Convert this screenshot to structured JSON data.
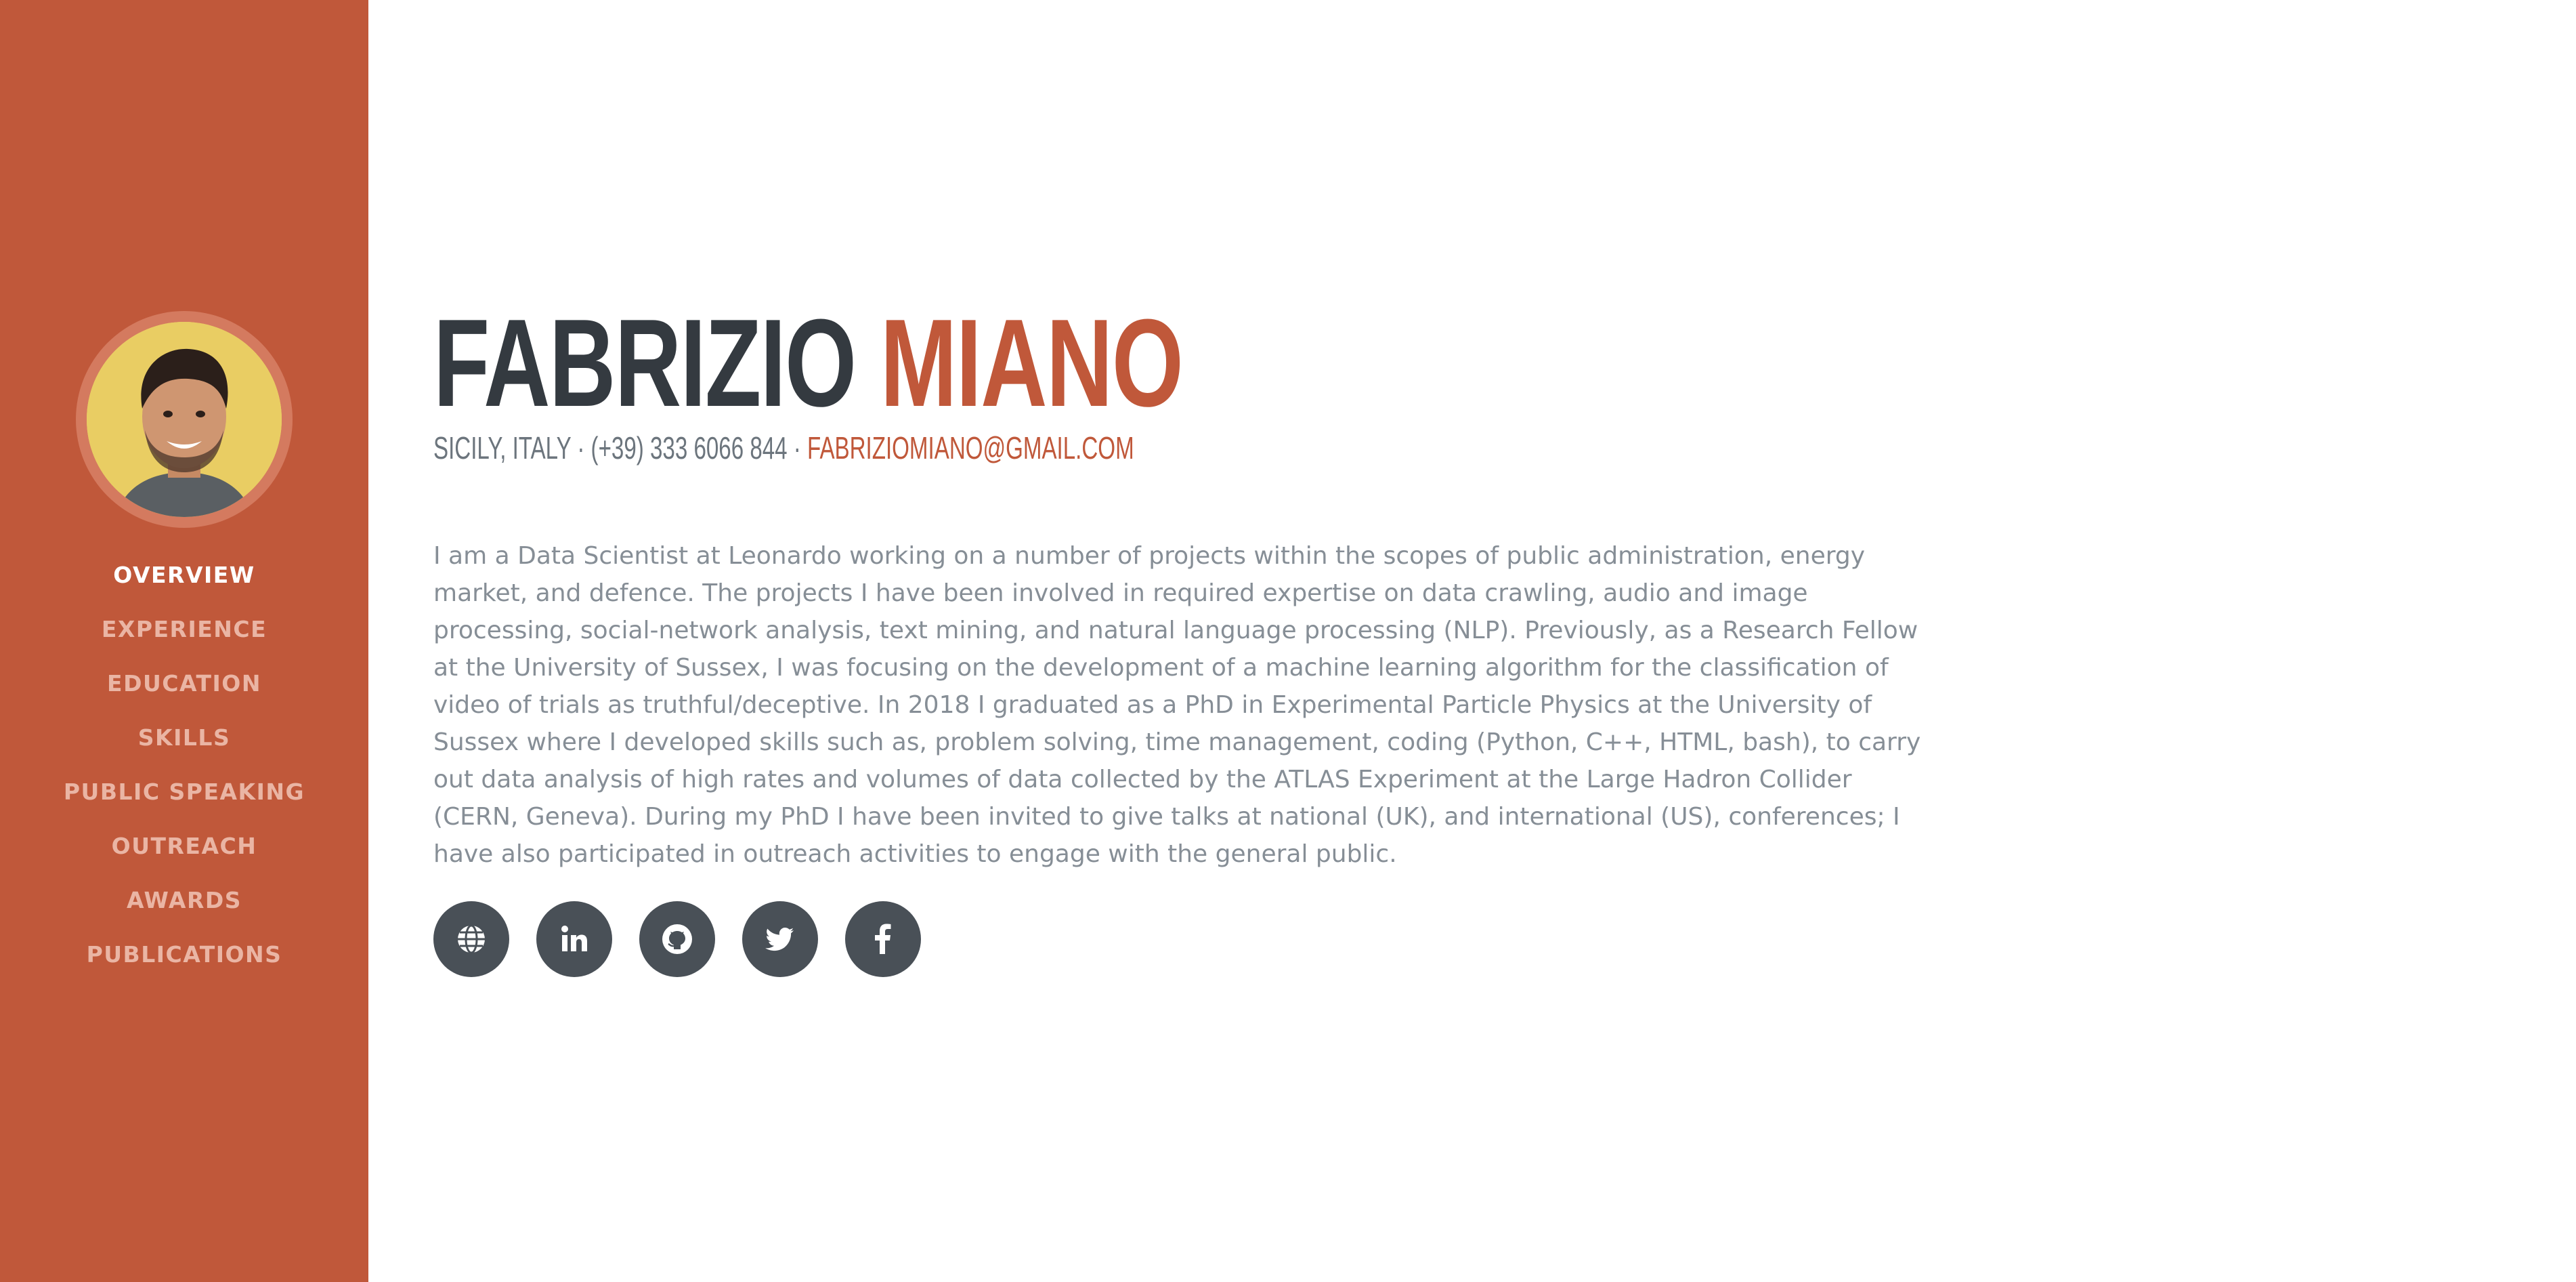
{
  "profile": {
    "first_name": "FABRIZIO",
    "last_name": "MIANO",
    "location_phone": "SICILY, ITALY · (+39) 333 6066 844 · ",
    "email": "FABRIZIOMIANO@GMAIL.COM",
    "bio": "I am a Data Scientist at Leonardo working on a number of projects within the scopes of public administration, energy market, and defence. The projects I have been involved in required expertise on data crawling, audio and image processing, social-network analysis, text mining, and natural language processing (NLP). Previously, as a Research Fellow at the University of Sussex, I was focusing on the development of a machine learning algorithm for the classification of video of trials as truthful/deceptive. In 2018 I graduated as a PhD in Experimental Particle Physics at the University of Sussex where I developed skills such as, problem solving, time management, coding (Python, C++, HTML, bash), to carry out data analysis of high rates and volumes of data collected by the ATLAS Experiment at the Large Hadron Collider (CERN, Geneva). During my PhD I have been invited to give talks at national (UK), and international (US), conferences; I have also participated in outreach activities to engage with the general public."
  },
  "sidebar": {
    "avatar_icon": "profile-photo",
    "items": [
      {
        "label": "OVERVIEW",
        "active": true
      },
      {
        "label": "EXPERIENCE",
        "active": false
      },
      {
        "label": "EDUCATION",
        "active": false
      },
      {
        "label": "SKILLS",
        "active": false
      },
      {
        "label": "PUBLIC SPEAKING",
        "active": false
      },
      {
        "label": "OUTREACH",
        "active": false
      },
      {
        "label": "AWARDS",
        "active": false
      },
      {
        "label": "PUBLICATIONS",
        "active": false
      }
    ]
  },
  "social_links": [
    {
      "icon": "globe-icon"
    },
    {
      "icon": "linkedin-icon"
    },
    {
      "icon": "github-icon"
    },
    {
      "icon": "twitter-icon"
    },
    {
      "icon": "facebook-icon"
    }
  ],
  "colors": {
    "accent": "#c0583a",
    "heading": "#343a40",
    "text_muted": "#868e96",
    "nav_inactive": "#eab5a4",
    "social_bg": "#495057"
  }
}
